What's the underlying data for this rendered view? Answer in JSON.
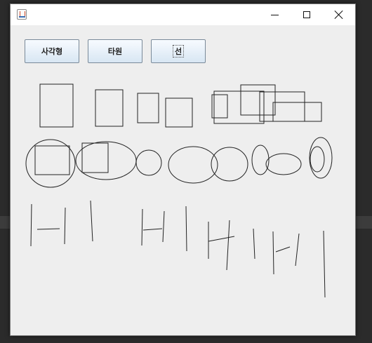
{
  "window": {
    "title": "",
    "controls": {
      "minimize": "minimize",
      "maximize": "maximize",
      "close": "close"
    }
  },
  "toolbar": {
    "buttons": [
      {
        "label": "사각형",
        "pressed": false
      },
      {
        "label": "타원",
        "pressed": false
      },
      {
        "label": "선",
        "pressed": false,
        "focused": true
      }
    ]
  },
  "drawing": {
    "shapes": [
      "rectangles",
      "ellipses",
      "lines"
    ]
  }
}
